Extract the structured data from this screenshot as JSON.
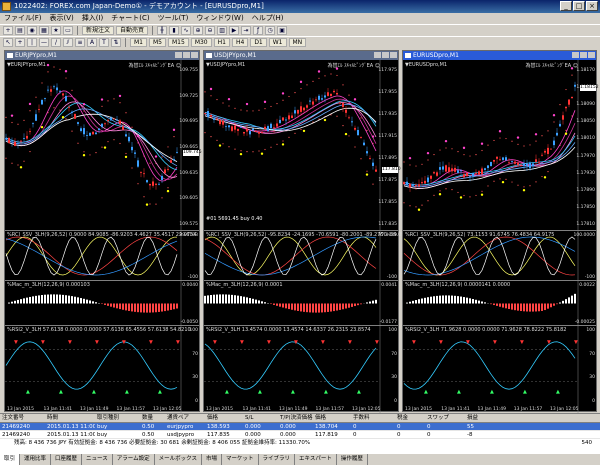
{
  "app": {
    "title": "1022402: FOREX.com Japan-Demo① - デモアカウント - [EURUSDpro,M1]",
    "window_buttons": [
      "_",
      "□",
      "×"
    ]
  },
  "menu": [
    "ファイル(F)",
    "表示(V)",
    "挿入(I)",
    "チャート(C)",
    "ツール(T)",
    "ウィンドウ(W)",
    "ヘルプ(H)"
  ],
  "toolbar": {
    "new_order": "新規注文",
    "auto_trade": "自動売買",
    "timeframes": [
      "M1",
      "M5",
      "M15",
      "M30",
      "H1",
      "H4",
      "D1",
      "W1",
      "MN"
    ]
  },
  "charts": [
    {
      "title": "EURJPYpro,M1",
      "symbol_label": "▼EURJPYpro,M1",
      "ea_label": "為替ｴﾙ ｽｷｬﾙﾋﾟﾝｸﾞEA ☺",
      "price_axis": [
        "109.755",
        "109.725",
        "109.695",
        "109.665",
        "109.635",
        "109.605",
        "109.575"
      ],
      "last_price": "109.745",
      "ind1": "%RCI_SSV_3LH(9,26,52) 0.9000 84.9085 -86.9203 4.4627 35.4517 22.9754",
      "ind1_axis": [
        "99.6103",
        "-100"
      ],
      "ind2": "%Mac_m_3LH(12,26,9) 0.000103",
      "ind2_axis": [
        "0.0040",
        "-0.0050"
      ],
      "ind3": "%RSI2_V_3LH 57.6138 0.0000 0.0000 57.6138 65.4556 57.6138 54.8210",
      "ind3_axis": [
        "100",
        "70",
        "30",
        "0"
      ],
      "x_axis": [
        "13 Jan 2015",
        "13 Jan 11:41",
        "13 Jan 11:49",
        "13 Jan 11:57",
        "13 Jan 12:05"
      ],
      "active": false
    },
    {
      "title": "USDJPYpro,M1",
      "symbol_label": "▼USDJPYpro,M1",
      "ea_label": "為替ｴﾙ ｽｷｬﾙﾋﾟﾝｸﾞEA ☺",
      "price_axis": [
        "117.975",
        "117.955",
        "117.935",
        "117.915",
        "117.895",
        "117.875",
        "117.855",
        "117.835"
      ],
      "last_price": "117.810",
      "box_label": "#01 5691.45 buy 0.40",
      "ind1": "%RCI_SSV_3LH(9,26,52) -95.8234 -24.1695 -70.6591 -80.2001 -89.2750 -59.0990",
      "ind1_axis": [
        "97.8049",
        "-100"
      ],
      "ind2": "%Mac_m_3LH(12,26,9) 0.0001",
      "ind2_axis": [
        "0.0041",
        "-0.0177"
      ],
      "ind3": "%RSI2_V_3LH 13.4574 0.0000 13.4574 14.6337 26.2315 23.8574",
      "ind3_axis": [
        "100",
        "70",
        "30",
        "0"
      ],
      "x_axis": [
        "13 Jan 2015",
        "13 Jan 11:41",
        "13 Jan 11:49",
        "13 Jan 11:57",
        "13 Jan 12:05"
      ],
      "active": false
    },
    {
      "title": "EURUSDpro,M1",
      "symbol_label": "▼EURUSDpro,M1",
      "ea_label": "為替ｴﾙ ｽｷｬﾙﾋﾟﾝｸﾞEA ☺",
      "price_axis": [
        "1.18170",
        "1.18130",
        "1.18090",
        "1.18050",
        "1.18010",
        "1.17970",
        "1.17930",
        "1.17890",
        "1.17850",
        "1.17810"
      ],
      "last_price": "1.18152",
      "ind1": "%RCI_SSV_3LH(9,26,52) 73.1153 91.6745 76.4834 64.9175",
      "ind1_axis": [
        "100.0000",
        "-100"
      ],
      "ind2": "%Mac_m_3LH(12,26,9) 0.0000141 0.0000",
      "ind2_axis": [
        "0.0022",
        "-0.00025"
      ],
      "ind3": "%RSI2_V_3LH 71.9628 0.0000 0.0000 71.9628 78.8222 75.8182",
      "ind3_axis": [
        "100",
        "70",
        "30",
        "0"
      ],
      "x_axis": [
        "13 Jan 2015",
        "13 Jan 11:41",
        "13 Jan 11:49",
        "13 Jan 11:57",
        "13 Jan 12:05"
      ],
      "active": true
    }
  ],
  "terminal": {
    "headers": [
      "注文番号",
      "時間",
      "取引種別",
      "数量",
      "通貨ペア",
      "価格",
      "S/L",
      "T/P(決済価格)",
      "価格",
      "手数料",
      "税金",
      "スワップ",
      "損益"
    ],
    "rows": [
      [
        "21469240",
        "2015.01.13 11:00:00",
        "buy",
        "0.50",
        "eurjpypro",
        "138.593",
        "0.000",
        "0.000",
        "138.704",
        "0",
        "0",
        "0",
        "55"
      ],
      [
        "21469240",
        "2015.01.13 11:00:00",
        "buy",
        "0.50",
        "usdjpypro",
        "117.835",
        "0.000",
        "0.000",
        "117.819",
        "0",
        "0",
        "0",
        "-8"
      ]
    ],
    "balance": "残高: 8 436 736 JPY  有効証拠金: 8 436 736  必要証拠金: 30 681  余剰証拠金: 8 406 055  証拠金維持率: 11330.70%",
    "total": "540"
  },
  "tabs": [
    "取引",
    "運用比率",
    "口座履歴",
    "ニュース",
    "アラーム設定",
    "メールボックス",
    "市場",
    "マーケット",
    "ライブラリ",
    "エキスパート",
    "操作履歴"
  ],
  "colors": {
    "background": "#000000",
    "bull_candle": "#3aa0ff",
    "bear_candle": "#ff3333",
    "ma_magenta": "#ff44cc",
    "ma_cyan": "#33ccff",
    "signal_yellow": "#ffff00",
    "band_dots": "#ff5555"
  }
}
